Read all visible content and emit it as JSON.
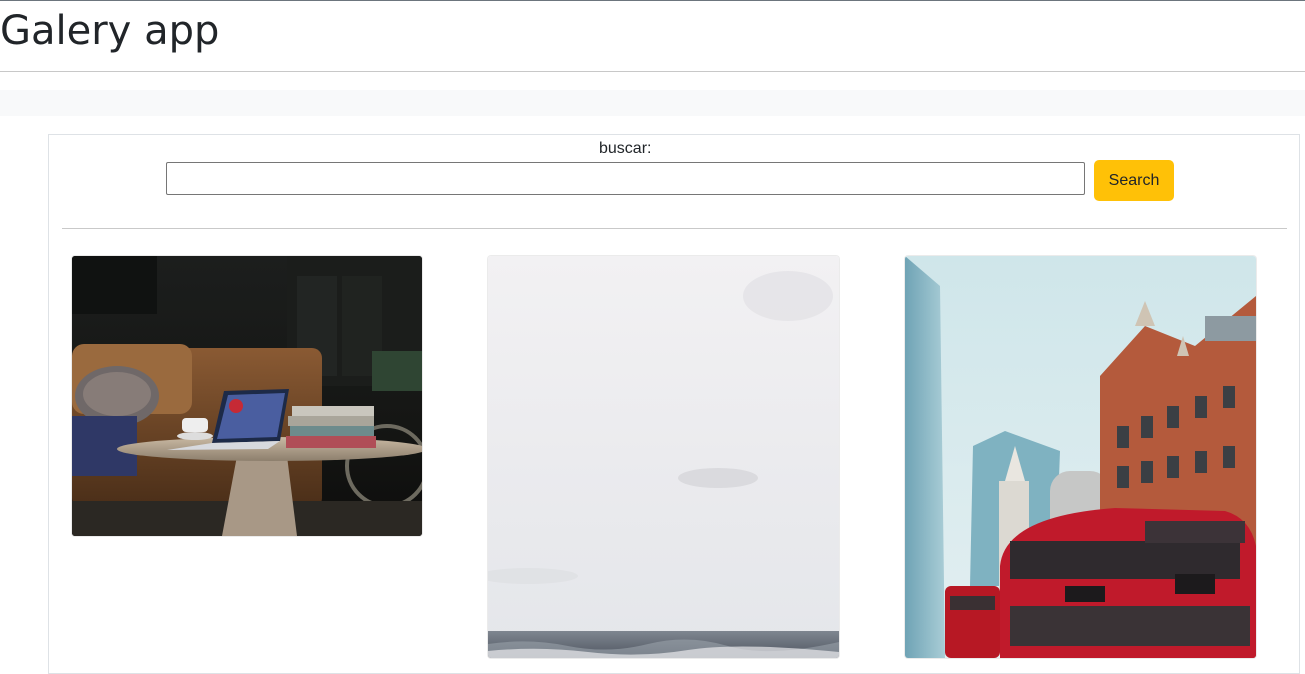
{
  "app": {
    "title": "Galery app"
  },
  "search": {
    "label": "buscar:",
    "input_value": "",
    "placeholder": "",
    "button_label": "Search"
  },
  "gallery": {
    "images": [
      {
        "subject": "laptop on round coffee table in dark living room"
      },
      {
        "subject": "overcast sky over the sea"
      },
      {
        "subject": "red double-decker bus in London street"
      }
    ]
  },
  "colors": {
    "accent_button": "#ffc107",
    "band": "#f8f9fa",
    "border": "#dee2e6"
  }
}
